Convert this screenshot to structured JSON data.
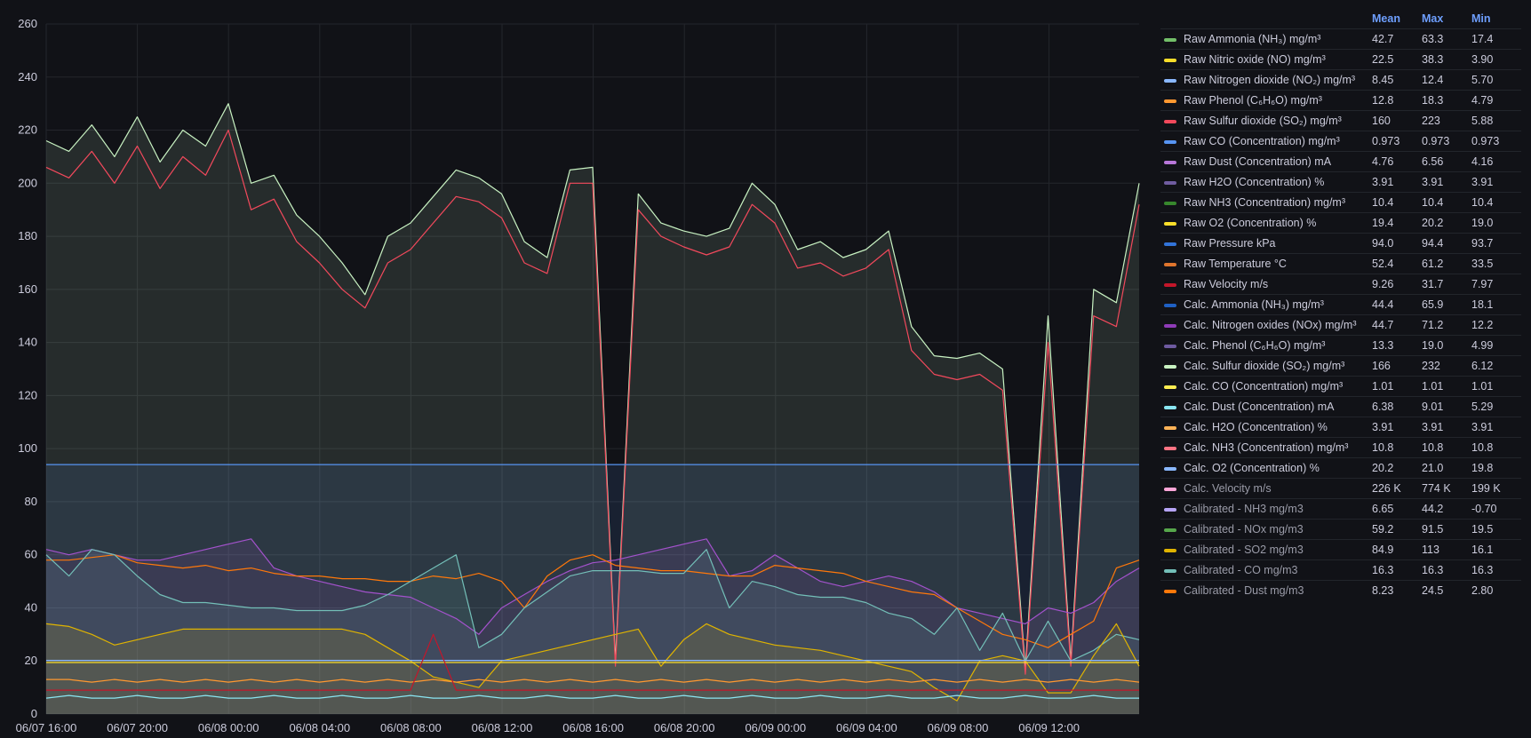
{
  "chart_data": {
    "type": "area",
    "ylim": [
      0,
      260
    ],
    "yticks": [
      "0",
      "20",
      "40",
      "60",
      "80",
      "100",
      "120",
      "140",
      "160",
      "180",
      "200",
      "220",
      "240",
      "260"
    ],
    "xticks": [
      "06/07 16:00",
      "06/07 20:00",
      "06/08 00:00",
      "06/08 04:00",
      "06/08 08:00",
      "06/08 12:00",
      "06/08 16:00",
      "06/08 20:00",
      "06/09 00:00",
      "06/09 04:00",
      "06/09 08:00",
      "06/09 12:00"
    ],
    "x": [
      0,
      1,
      2,
      3,
      4,
      5,
      6,
      7,
      8,
      9,
      10,
      11,
      12,
      13,
      14,
      15,
      16,
      17,
      18,
      19,
      20,
      21,
      22,
      23,
      24,
      25,
      26,
      27,
      28,
      29,
      30,
      31,
      32,
      33,
      34,
      35,
      36,
      37,
      38,
      39,
      40,
      41,
      42,
      43,
      44,
      45,
      46,
      47,
      48
    ],
    "series": [
      {
        "name": "Calc. Sulfur dioxide (SO₂) mg/m³",
        "color": "#c8f2c2",
        "fill": true,
        "values": [
          216,
          212,
          222,
          210,
          225,
          208,
          220,
          214,
          230,
          200,
          203,
          188,
          180,
          170,
          158,
          180,
          185,
          195,
          205,
          202,
          196,
          178,
          172,
          205,
          206,
          20,
          196,
          185,
          182,
          180,
          183,
          200,
          192,
          175,
          178,
          172,
          175,
          182,
          146,
          135,
          134,
          136,
          130,
          17,
          150,
          20,
          160,
          155,
          200
        ]
      },
      {
        "name": "Raw Sulfur dioxide (SO₂) mg/m³",
        "color": "#f2495c",
        "fill": false,
        "values": [
          206,
          202,
          212,
          200,
          214,
          198,
          210,
          203,
          220,
          190,
          194,
          178,
          170,
          160,
          153,
          170,
          175,
          185,
          195,
          193,
          187,
          170,
          166,
          200,
          200,
          18,
          190,
          180,
          176,
          173,
          176,
          192,
          185,
          168,
          170,
          165,
          168,
          175,
          137,
          128,
          126,
          128,
          122,
          15,
          140,
          18,
          150,
          146,
          192
        ]
      },
      {
        "name": "Raw Pressure kPa",
        "color": "#5794f2",
        "fill": true,
        "values": [
          94,
          94,
          94,
          94,
          94,
          94,
          94,
          94,
          94,
          94,
          94,
          94,
          94,
          94,
          94,
          94,
          94,
          94,
          94,
          94,
          94,
          94,
          94,
          94,
          94,
          94,
          94,
          94,
          94,
          94,
          94,
          94,
          94,
          94,
          94,
          94,
          94,
          94,
          94,
          94,
          94,
          94,
          94,
          94,
          94,
          94,
          94,
          94,
          94
        ]
      },
      {
        "name": "Calc. Nitrogen oxides (NOx) mg/m³",
        "color": "#a352cc",
        "fill": true,
        "values": [
          62,
          60,
          62,
          60,
          58,
          58,
          60,
          62,
          64,
          66,
          55,
          52,
          50,
          48,
          46,
          45,
          44,
          40,
          36,
          30,
          40,
          45,
          50,
          54,
          57,
          58,
          60,
          62,
          64,
          66,
          52,
          54,
          60,
          55,
          50,
          48,
          50,
          52,
          50,
          46,
          40,
          38,
          36,
          34,
          40,
          38,
          42,
          50,
          55
        ]
      },
      {
        "name": "Calibrated - Dust mg/m3",
        "color": "#ff780a",
        "fill": false,
        "values": [
          58,
          58,
          59,
          60,
          57,
          56,
          55,
          56,
          54,
          55,
          53,
          52,
          52,
          51,
          51,
          50,
          50,
          52,
          51,
          53,
          50,
          40,
          52,
          58,
          60,
          56,
          55,
          54,
          54,
          53,
          52,
          52,
          56,
          55,
          54,
          53,
          50,
          48,
          46,
          45,
          40,
          35,
          30,
          28,
          25,
          30,
          35,
          55,
          58
        ]
      },
      {
        "name": "Calibrated - CO mg/m3",
        "color": "#73bfb8",
        "fill": true,
        "values": [
          60,
          52,
          62,
          60,
          52,
          45,
          42,
          42,
          41,
          40,
          40,
          39,
          39,
          39,
          41,
          45,
          50,
          55,
          60,
          25,
          30,
          40,
          46,
          52,
          54,
          54,
          54,
          53,
          53,
          62,
          40,
          50,
          48,
          45,
          44,
          44,
          42,
          38,
          36,
          30,
          40,
          24,
          38,
          20,
          35,
          20,
          24,
          30,
          28
        ]
      },
      {
        "name": "Calibrated - SO2 mg/m3",
        "color": "#e0b400",
        "fill": true,
        "values": [
          34,
          33,
          30,
          26,
          28,
          30,
          32,
          32,
          32,
          32,
          32,
          32,
          32,
          32,
          30,
          25,
          20,
          14,
          12,
          10,
          20,
          22,
          24,
          26,
          28,
          30,
          32,
          18,
          28,
          34,
          30,
          28,
          26,
          25,
          24,
          22,
          20,
          18,
          16,
          10,
          5,
          20,
          22,
          20,
          8,
          8,
          22,
          34,
          18
        ]
      },
      {
        "name": "Raw O2 (Concentration) %",
        "color": "#fade2a",
        "fill": false,
        "values": [
          19.4,
          19.4,
          19.4,
          19.4,
          19.4,
          19.4,
          19.4,
          19.4,
          19.4,
          19.4,
          19.4,
          19.4,
          19.4,
          19.4,
          19.4,
          19.4,
          19.4,
          19.4,
          19.4,
          19.4,
          19.4,
          19.4,
          19.4,
          19.4,
          19.4,
          19.4,
          19.4,
          19.4,
          19.4,
          19.4,
          19.4,
          19.4,
          19.4,
          19.4,
          19.4,
          19.4,
          19.4,
          19.4,
          19.4,
          19.4,
          19.4,
          19.4,
          19.4,
          19.4,
          19.4,
          19.4,
          19.4,
          19.4,
          19.4
        ]
      },
      {
        "name": "Calc. O2 (Concentration) %",
        "color": "#8ab8ff",
        "fill": false,
        "values": [
          20.2,
          20.2,
          20.2,
          20.2,
          20.2,
          20.2,
          20.2,
          20.2,
          20.2,
          20.2,
          20.2,
          20.2,
          20.2,
          20.2,
          20.2,
          20.2,
          20.2,
          20.2,
          20.2,
          20.2,
          20.2,
          20.2,
          20.2,
          20.2,
          20.2,
          20.2,
          20.2,
          20.2,
          20.2,
          20.2,
          20.2,
          20.2,
          20.2,
          20.2,
          20.2,
          20.2,
          20.2,
          20.2,
          20.2,
          20.2,
          20.2,
          20.2,
          20.2,
          20.2,
          20.2,
          20.2,
          20.2,
          20.2,
          20.2
        ]
      },
      {
        "name": "Raw Phenol (C₆H₆O) mg/m³",
        "color": "#ff9830",
        "fill": false,
        "values": [
          13,
          13,
          12,
          13,
          12,
          13,
          12,
          13,
          12,
          13,
          12,
          13,
          12,
          13,
          12,
          13,
          12,
          13,
          12,
          13,
          12,
          13,
          12,
          13,
          12,
          13,
          12,
          13,
          12,
          13,
          12,
          13,
          12,
          13,
          12,
          13,
          12,
          13,
          12,
          13,
          12,
          13,
          12,
          13,
          12,
          13,
          12,
          13,
          12
        ]
      },
      {
        "name": "Raw Velocity m/s",
        "color": "#c4162a",
        "fill": false,
        "values": [
          9,
          9,
          9,
          9,
          9,
          9,
          9,
          9,
          9,
          9,
          9,
          9,
          9,
          9,
          9,
          9,
          9,
          30,
          9,
          9,
          9,
          9,
          9,
          9,
          9,
          9,
          9,
          9,
          9,
          9,
          9,
          9,
          9,
          9,
          9,
          9,
          9,
          9,
          9,
          9,
          9,
          9,
          9,
          9,
          9,
          9,
          9,
          9,
          9
        ]
      },
      {
        "name": "Calc. Dust (Concentration) mA",
        "color": "#8ae6f2",
        "fill": false,
        "values": [
          6,
          7,
          6,
          6,
          7,
          6,
          6,
          7,
          6,
          6,
          7,
          6,
          6,
          7,
          6,
          6,
          7,
          6,
          6,
          7,
          6,
          6,
          7,
          6,
          6,
          7,
          6,
          6,
          7,
          6,
          6,
          7,
          6,
          6,
          7,
          6,
          6,
          7,
          6,
          6,
          7,
          6,
          6,
          7,
          6,
          6,
          7,
          6,
          6
        ]
      }
    ]
  },
  "legend": {
    "headers": [
      "Mean",
      "Max",
      "Min"
    ],
    "rows": [
      {
        "name": "Raw Ammonia (NH₃) mg/m³",
        "color": "#73bf69",
        "mean": "42.7",
        "max": "63.3",
        "min": "17.4",
        "dim": false
      },
      {
        "name": "Raw Nitric oxide (NO) mg/m³",
        "color": "#fade2a",
        "mean": "22.5",
        "max": "38.3",
        "min": "3.90",
        "dim": false
      },
      {
        "name": "Raw Nitrogen dioxide (NO₂) mg/m³",
        "color": "#8ab8ff",
        "mean": "8.45",
        "max": "12.4",
        "min": "5.70",
        "dim": false
      },
      {
        "name": "Raw Phenol (C₆H₆O) mg/m³",
        "color": "#ff9830",
        "mean": "12.8",
        "max": "18.3",
        "min": "4.79",
        "dim": false
      },
      {
        "name": "Raw Sulfur dioxide (SO₂) mg/m³",
        "color": "#f2495c",
        "mean": "160",
        "max": "223",
        "min": "5.88",
        "dim": false
      },
      {
        "name": "Raw CO (Concentration) mg/m³",
        "color": "#5794f2",
        "mean": "0.973",
        "max": "0.973",
        "min": "0.973",
        "dim": false
      },
      {
        "name": "Raw Dust (Concentration) mA",
        "color": "#b877d9",
        "mean": "4.76",
        "max": "6.56",
        "min": "4.16",
        "dim": false
      },
      {
        "name": "Raw H2O (Concentration) %",
        "color": "#705da0",
        "mean": "3.91",
        "max": "3.91",
        "min": "3.91",
        "dim": false
      },
      {
        "name": "Raw NH3 (Concentration) mg/m³",
        "color": "#37872d",
        "mean": "10.4",
        "max": "10.4",
        "min": "10.4",
        "dim": false
      },
      {
        "name": "Raw O2 (Concentration) %",
        "color": "#fade2a",
        "mean": "19.4",
        "max": "20.2",
        "min": "19.0",
        "dim": false
      },
      {
        "name": "Raw Pressure kPa",
        "color": "#3274d9",
        "mean": "94.0",
        "max": "94.4",
        "min": "93.7",
        "dim": false
      },
      {
        "name": "Raw Temperature °C",
        "color": "#e0752d",
        "mean": "52.4",
        "max": "61.2",
        "min": "33.5",
        "dim": false
      },
      {
        "name": "Raw Velocity m/s",
        "color": "#c4162a",
        "mean": "9.26",
        "max": "31.7",
        "min": "7.97",
        "dim": false
      },
      {
        "name": "Calc. Ammonia (NH₃) mg/m³",
        "color": "#1f60c4",
        "mean": "44.4",
        "max": "65.9",
        "min": "18.1",
        "dim": false
      },
      {
        "name": "Calc. Nitrogen oxides (NOx) mg/m³",
        "color": "#8f3bb8",
        "mean": "44.7",
        "max": "71.2",
        "min": "12.2",
        "dim": false
      },
      {
        "name": "Calc. Phenol (C₆H₆O) mg/m³",
        "color": "#6e5aa0",
        "mean": "13.3",
        "max": "19.0",
        "min": "4.99",
        "dim": false
      },
      {
        "name": "Calc. Sulfur dioxide (SO₂) mg/m³",
        "color": "#c8f2c2",
        "mean": "166",
        "max": "232",
        "min": "6.12",
        "dim": false
      },
      {
        "name": "Calc. CO (Concentration) mg/m³",
        "color": "#ffee52",
        "mean": "1.01",
        "max": "1.01",
        "min": "1.01",
        "dim": false
      },
      {
        "name": "Calc. Dust (Concentration) mA",
        "color": "#8ae6f2",
        "mean": "6.38",
        "max": "9.01",
        "min": "5.29",
        "dim": false
      },
      {
        "name": "Calc. H2O (Concentration) %",
        "color": "#ffb357",
        "mean": "3.91",
        "max": "3.91",
        "min": "3.91",
        "dim": false
      },
      {
        "name": "Calc. NH3 (Concentration) mg/m³",
        "color": "#ff7383",
        "mean": "10.8",
        "max": "10.8",
        "min": "10.8",
        "dim": false
      },
      {
        "name": "Calc. O2 (Concentration) %",
        "color": "#8ab8ff",
        "mean": "20.2",
        "max": "21.0",
        "min": "19.8",
        "dim": false
      },
      {
        "name": "Calc. Velocity m/s",
        "color": "#ffa6d8",
        "mean": "226 K",
        "max": "774 K",
        "min": "199 K",
        "dim": true
      },
      {
        "name": "Calibrated - NH3 mg/m3",
        "color": "#b6a4f7",
        "mean": "6.65",
        "max": "44.2",
        "min": "-0.70",
        "dim": true
      },
      {
        "name": "Calibrated - NOx mg/m3",
        "color": "#56a64b",
        "mean": "59.2",
        "max": "91.5",
        "min": "19.5",
        "dim": true
      },
      {
        "name": "Calibrated - SO2 mg/m3",
        "color": "#e0b400",
        "mean": "84.9",
        "max": "113",
        "min": "16.1",
        "dim": true
      },
      {
        "name": "Calibrated - CO mg/m3",
        "color": "#73bfb8",
        "mean": "16.3",
        "max": "16.3",
        "min": "16.3",
        "dim": true
      },
      {
        "name": "Calibrated - Dust mg/m3",
        "color": "#ff780a",
        "mean": "8.23",
        "max": "24.5",
        "min": "2.80",
        "dim": true
      }
    ]
  }
}
